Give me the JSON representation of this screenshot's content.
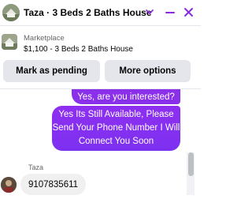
{
  "header": {
    "title": "Taza · 3 Beds 2 Baths House",
    "icons": [
      "avatar",
      "chevron-down-icon",
      "minimize-icon",
      "close-icon"
    ],
    "accent": "#8a2be2"
  },
  "listing": {
    "source": "Marketplace",
    "price_title": "$1,100 - 3 Beds 2 Baths House",
    "buttons": {
      "mark_pending": "Mark as pending",
      "more_options": "More options"
    }
  },
  "messages": {
    "outgoing": [
      "Yes, are you interested?",
      "Yes Its Still Available, Please Send Your Phone Number I Will Connect You Soon"
    ],
    "incoming": {
      "sender": "Taza",
      "text": "9107835611"
    }
  }
}
